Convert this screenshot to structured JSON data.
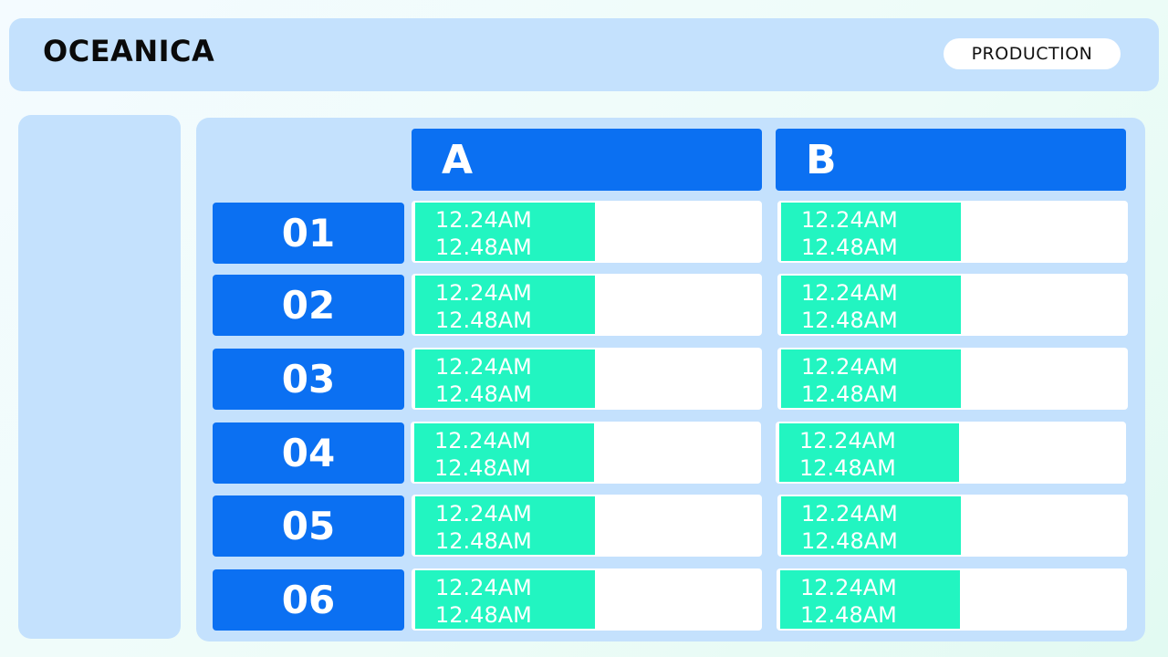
{
  "app": {
    "title": "OCEANICA",
    "environment": "PRODUCTION"
  },
  "columns": [
    "A",
    "B"
  ],
  "rows": [
    {
      "label": "01",
      "cells": [
        {
          "start": "12.24AM",
          "end": "12.48AM"
        },
        {
          "start": "12.24AM",
          "end": "12.48AM"
        }
      ]
    },
    {
      "label": "02",
      "cells": [
        {
          "start": "12.24AM",
          "end": "12.48AM"
        },
        {
          "start": "12.24AM",
          "end": "12.48AM"
        }
      ]
    },
    {
      "label": "03",
      "cells": [
        {
          "start": "12.24AM",
          "end": "12.48AM"
        },
        {
          "start": "12.24AM",
          "end": "12.48AM"
        }
      ]
    },
    {
      "label": "04",
      "cells": [
        {
          "start": "12.24AM",
          "end": "12.48AM"
        },
        {
          "start": "12.24AM",
          "end": "12.48AM"
        }
      ]
    },
    {
      "label": "05",
      "cells": [
        {
          "start": "12.24AM",
          "end": "12.48AM"
        },
        {
          "start": "12.24AM",
          "end": "12.48AM"
        }
      ]
    },
    {
      "label": "06",
      "cells": [
        {
          "start": "12.24AM",
          "end": "12.48AM"
        },
        {
          "start": "12.24AM",
          "end": "12.48AM"
        }
      ]
    }
  ],
  "colors": {
    "accent": "#0b70f2",
    "slot": "#22f5c1",
    "panel": "#c4e1fd",
    "cell": "#ffffff"
  }
}
